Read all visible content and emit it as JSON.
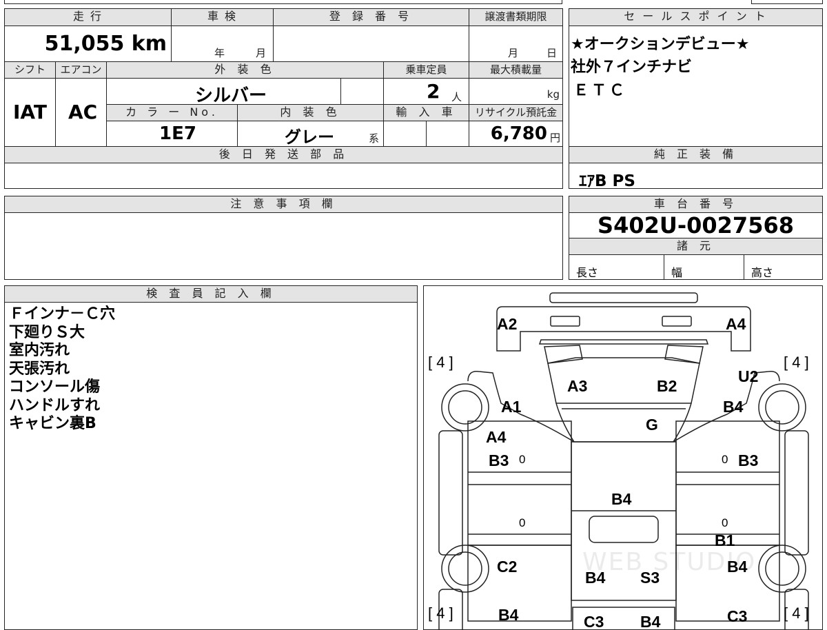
{
  "vehicle": {
    "mileage": "51,055 km",
    "shaken_label": "車 検",
    "shaken_year_unit": "年",
    "shaken_month_unit": "月",
    "registration_label": "登 録 番 号",
    "transfer_label": "譲渡書類期限",
    "transfer_month_unit": "月",
    "transfer_day_unit": "日",
    "mileage_label": "走 行",
    "shift_label": "シフト",
    "shift": "IAT",
    "aircon_label": "エアコン",
    "aircon": "AC",
    "exterior_color_label": "外 装 色",
    "exterior_color": "シルバー",
    "capacity_label": "乗車定員",
    "capacity": "2",
    "capacity_unit": "人",
    "max_load_label": "最大積載量",
    "max_load_unit": "kg",
    "color_no_label": "カ ラ ー No.",
    "color_no": "1E7",
    "interior_color_label": "内 装 色",
    "interior_color": "グレー",
    "interior_suffix": "系",
    "import_label": "輸 入 車",
    "recycle_label": "リサイクル預託金",
    "recycle_fee": "6,780",
    "recycle_unit": "円",
    "later_parts_label": "後 日 発 送 部 品",
    "notes_label": "注 意 事 項 欄"
  },
  "sales_points": {
    "label": "セ ー ル ス ポ イ ン ト",
    "lines": [
      "★オークションデビュー★",
      "社外７インチナビ",
      "ＥＴＣ"
    ]
  },
  "genuine_equipment": {
    "label": "純 正 装 備",
    "value": "ｴｱB PS"
  },
  "chassis": {
    "label": "車 台 番 号",
    "number": "S402U-0027568"
  },
  "specs": {
    "label": "諸 元",
    "length_label": "長さ",
    "width_label": "幅",
    "height_label": "高さ"
  },
  "inspector": {
    "label": "検 査 員 記 入 欄",
    "lines": [
      "Ｆインナ－Ｃ穴",
      "下廻りＳ大",
      "室内汚れ",
      "天張汚れ",
      "コンソール傷",
      "ハンドルすれ",
      "キャビン裏B"
    ]
  },
  "diagram": {
    "tire_marks": [
      "[ 4 ]",
      "[ 4 ]",
      "[ 4 ]",
      "[ 4 ]"
    ],
    "zeros": [
      "0",
      "0",
      "0",
      "0"
    ],
    "codes": {
      "a2": "A2",
      "a4_top": "A4",
      "a3": "A3",
      "b2": "B2",
      "u2": "U2",
      "a1": "A1",
      "b4_right": "B4",
      "g": "G",
      "a4_left": "A4",
      "b3_left": "B3",
      "b3_right": "B3",
      "b4_center": "B4",
      "b1": "B1",
      "c2": "C2",
      "b4_bottom_right": "B4",
      "b4_bed": "B4",
      "s3": "S3",
      "b4_bl": "B4",
      "c3_bc": "C3",
      "b4_bc": "B4",
      "c3_br": "C3"
    },
    "watermark": "WEB STUDIO"
  }
}
